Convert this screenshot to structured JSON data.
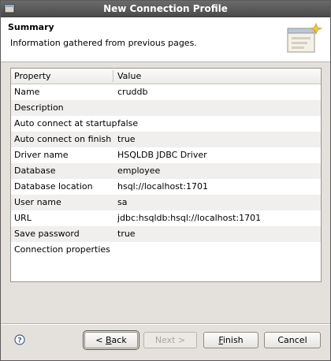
{
  "window": {
    "title": "New Connection Profile"
  },
  "header": {
    "title": "Summary",
    "description": "Information gathered from previous pages."
  },
  "table": {
    "columns": [
      "Property",
      "Value"
    ],
    "rows": [
      {
        "property": "Name",
        "value": "cruddb"
      },
      {
        "property": "Description",
        "value": ""
      },
      {
        "property": "Auto connect at startup",
        "value": "false"
      },
      {
        "property": "Auto connect on finish",
        "value": "true"
      },
      {
        "property": "Driver name",
        "value": "HSQLDB JDBC Driver"
      },
      {
        "property": "Database",
        "value": "employee"
      },
      {
        "property": "Database location",
        "value": "hsql://localhost:1701"
      },
      {
        "property": "User name",
        "value": "sa"
      },
      {
        "property": "URL",
        "value": "jdbc:hsqldb:hsql://localhost:1701"
      },
      {
        "property": "Save password",
        "value": "true"
      },
      {
        "property": "Connection properties",
        "value": ""
      }
    ]
  },
  "buttons": {
    "back": {
      "prefix": "< ",
      "mnemonic": "B",
      "rest": "ack"
    },
    "next": "Next >",
    "finish": {
      "mnemonic": "F",
      "rest": "inish"
    },
    "cancel": "Cancel"
  },
  "icons": {
    "title": "database-icon",
    "header": "wizard-banner-icon",
    "help": "help-icon"
  },
  "colors": {
    "titlebar": "#4a4a4a",
    "background": "#e4e1dc"
  }
}
